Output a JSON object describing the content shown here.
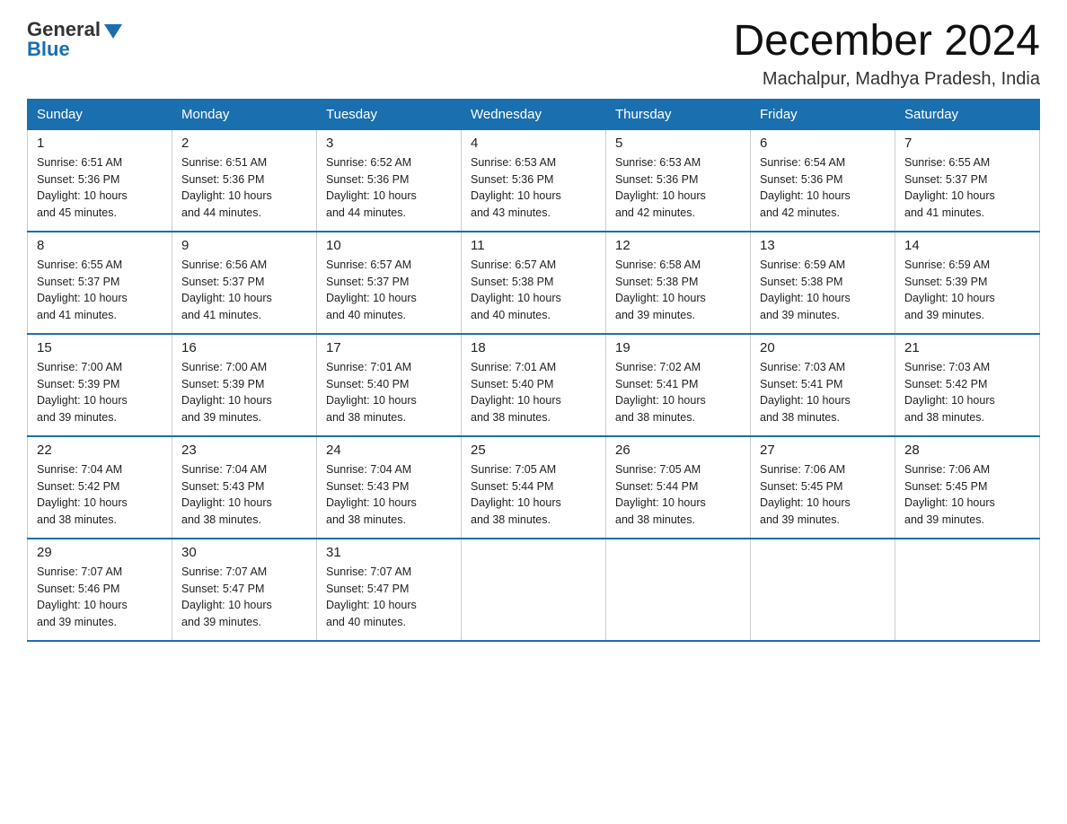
{
  "header": {
    "logo_general": "General",
    "logo_blue": "Blue",
    "month_title": "December 2024",
    "location": "Machalpur, Madhya Pradesh, India"
  },
  "weekdays": [
    "Sunday",
    "Monday",
    "Tuesday",
    "Wednesday",
    "Thursday",
    "Friday",
    "Saturday"
  ],
  "weeks": [
    [
      {
        "day": "1",
        "sunrise": "6:51 AM",
        "sunset": "5:36 PM",
        "daylight": "10 hours and 45 minutes."
      },
      {
        "day": "2",
        "sunrise": "6:51 AM",
        "sunset": "5:36 PM",
        "daylight": "10 hours and 44 minutes."
      },
      {
        "day": "3",
        "sunrise": "6:52 AM",
        "sunset": "5:36 PM",
        "daylight": "10 hours and 44 minutes."
      },
      {
        "day": "4",
        "sunrise": "6:53 AM",
        "sunset": "5:36 PM",
        "daylight": "10 hours and 43 minutes."
      },
      {
        "day": "5",
        "sunrise": "6:53 AM",
        "sunset": "5:36 PM",
        "daylight": "10 hours and 42 minutes."
      },
      {
        "day": "6",
        "sunrise": "6:54 AM",
        "sunset": "5:36 PM",
        "daylight": "10 hours and 42 minutes."
      },
      {
        "day": "7",
        "sunrise": "6:55 AM",
        "sunset": "5:37 PM",
        "daylight": "10 hours and 41 minutes."
      }
    ],
    [
      {
        "day": "8",
        "sunrise": "6:55 AM",
        "sunset": "5:37 PM",
        "daylight": "10 hours and 41 minutes."
      },
      {
        "day": "9",
        "sunrise": "6:56 AM",
        "sunset": "5:37 PM",
        "daylight": "10 hours and 41 minutes."
      },
      {
        "day": "10",
        "sunrise": "6:57 AM",
        "sunset": "5:37 PM",
        "daylight": "10 hours and 40 minutes."
      },
      {
        "day": "11",
        "sunrise": "6:57 AM",
        "sunset": "5:38 PM",
        "daylight": "10 hours and 40 minutes."
      },
      {
        "day": "12",
        "sunrise": "6:58 AM",
        "sunset": "5:38 PM",
        "daylight": "10 hours and 39 minutes."
      },
      {
        "day": "13",
        "sunrise": "6:59 AM",
        "sunset": "5:38 PM",
        "daylight": "10 hours and 39 minutes."
      },
      {
        "day": "14",
        "sunrise": "6:59 AM",
        "sunset": "5:39 PM",
        "daylight": "10 hours and 39 minutes."
      }
    ],
    [
      {
        "day": "15",
        "sunrise": "7:00 AM",
        "sunset": "5:39 PM",
        "daylight": "10 hours and 39 minutes."
      },
      {
        "day": "16",
        "sunrise": "7:00 AM",
        "sunset": "5:39 PM",
        "daylight": "10 hours and 39 minutes."
      },
      {
        "day": "17",
        "sunrise": "7:01 AM",
        "sunset": "5:40 PM",
        "daylight": "10 hours and 38 minutes."
      },
      {
        "day": "18",
        "sunrise": "7:01 AM",
        "sunset": "5:40 PM",
        "daylight": "10 hours and 38 minutes."
      },
      {
        "day": "19",
        "sunrise": "7:02 AM",
        "sunset": "5:41 PM",
        "daylight": "10 hours and 38 minutes."
      },
      {
        "day": "20",
        "sunrise": "7:03 AM",
        "sunset": "5:41 PM",
        "daylight": "10 hours and 38 minutes."
      },
      {
        "day": "21",
        "sunrise": "7:03 AM",
        "sunset": "5:42 PM",
        "daylight": "10 hours and 38 minutes."
      }
    ],
    [
      {
        "day": "22",
        "sunrise": "7:04 AM",
        "sunset": "5:42 PM",
        "daylight": "10 hours and 38 minutes."
      },
      {
        "day": "23",
        "sunrise": "7:04 AM",
        "sunset": "5:43 PM",
        "daylight": "10 hours and 38 minutes."
      },
      {
        "day": "24",
        "sunrise": "7:04 AM",
        "sunset": "5:43 PM",
        "daylight": "10 hours and 38 minutes."
      },
      {
        "day": "25",
        "sunrise": "7:05 AM",
        "sunset": "5:44 PM",
        "daylight": "10 hours and 38 minutes."
      },
      {
        "day": "26",
        "sunrise": "7:05 AM",
        "sunset": "5:44 PM",
        "daylight": "10 hours and 38 minutes."
      },
      {
        "day": "27",
        "sunrise": "7:06 AM",
        "sunset": "5:45 PM",
        "daylight": "10 hours and 39 minutes."
      },
      {
        "day": "28",
        "sunrise": "7:06 AM",
        "sunset": "5:45 PM",
        "daylight": "10 hours and 39 minutes."
      }
    ],
    [
      {
        "day": "29",
        "sunrise": "7:07 AM",
        "sunset": "5:46 PM",
        "daylight": "10 hours and 39 minutes."
      },
      {
        "day": "30",
        "sunrise": "7:07 AM",
        "sunset": "5:47 PM",
        "daylight": "10 hours and 39 minutes."
      },
      {
        "day": "31",
        "sunrise": "7:07 AM",
        "sunset": "5:47 PM",
        "daylight": "10 hours and 40 minutes."
      },
      null,
      null,
      null,
      null
    ]
  ],
  "labels": {
    "sunrise": "Sunrise: ",
    "sunset": "Sunset: ",
    "daylight": "Daylight: "
  }
}
